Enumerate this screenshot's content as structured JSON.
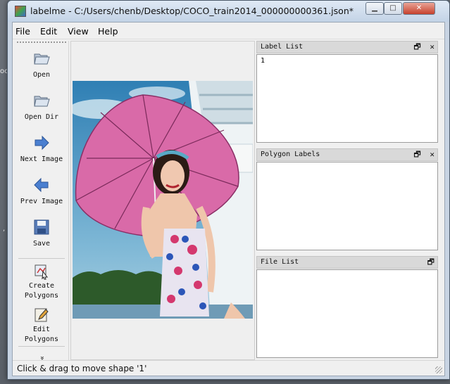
{
  "desktop": {
    "left_text": "oc",
    "left_text2": ","
  },
  "window": {
    "title": "labelme - C:/Users/chenb/Desktop/COCO_train2014_000000000361.json*",
    "min_glyph": "▁",
    "max_glyph": "□",
    "close_glyph": "✕"
  },
  "menu": {
    "file": "File",
    "edit": "Edit",
    "view": "View",
    "help": "Help"
  },
  "toolbar": {
    "open": "Open",
    "open_dir": "Open Dir",
    "next_image": "Next Image",
    "prev_image": "Prev Image",
    "save": "Save",
    "create_polygons_1": "Create",
    "create_polygons_2": "Polygons",
    "edit_polygons_1": "Edit",
    "edit_polygons_2": "Polygons",
    "more": "»"
  },
  "docks": {
    "label_list": {
      "title": "Label List",
      "items": [
        "1"
      ]
    },
    "polygon_labels": {
      "title": "Polygon Labels",
      "items": []
    },
    "file_list": {
      "title": "File List",
      "items": []
    },
    "float_glyph": "🗗",
    "close_glyph": "✕"
  },
  "status": {
    "text": "Click & drag to move shape '1'"
  },
  "colors": {
    "accent": "#4a7fd0",
    "umbrella": "#d96aa8",
    "sky": "#3a86b8"
  }
}
